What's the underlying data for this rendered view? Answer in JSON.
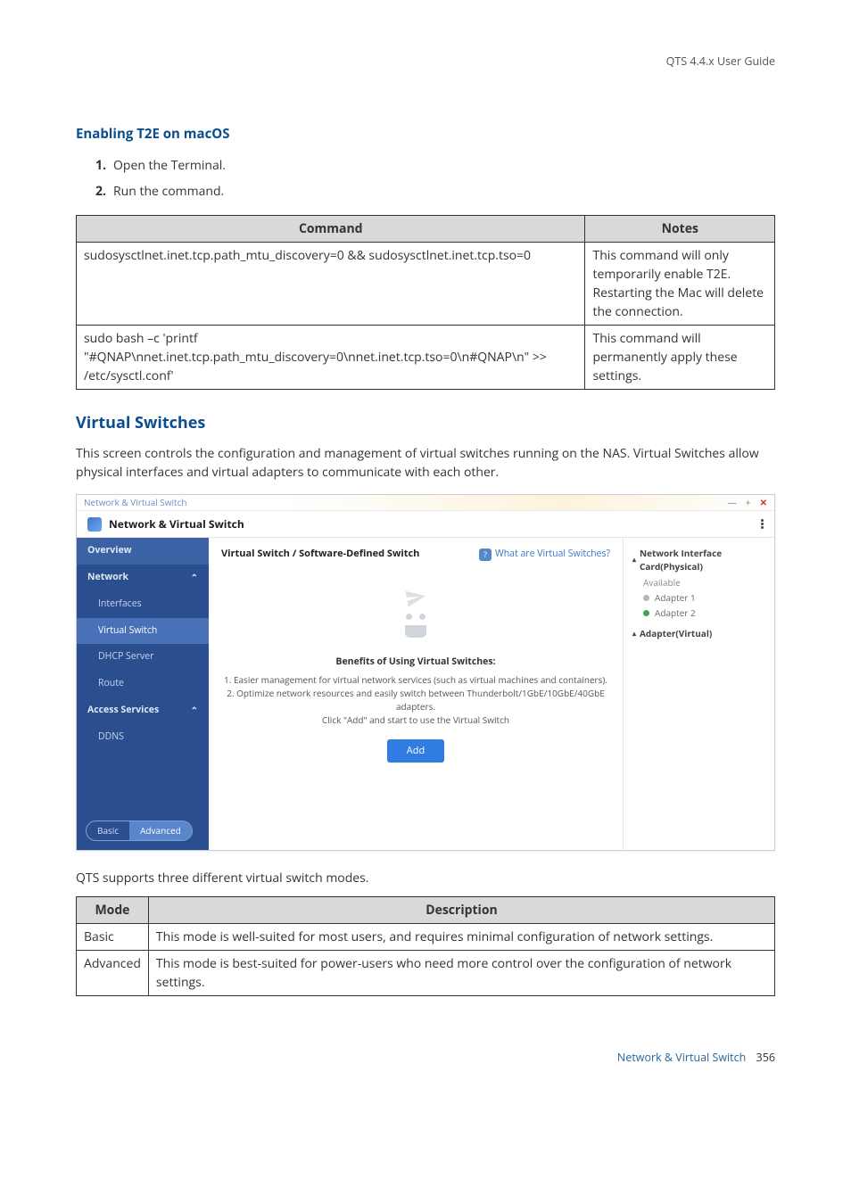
{
  "header": {
    "doc_title": "QTS 4.4.x User Guide"
  },
  "section1": {
    "heading": "Enabling T2E on macOS",
    "steps": [
      {
        "num": "1.",
        "text": "Open the Terminal."
      },
      {
        "num": "2.",
        "text": "Run the command."
      }
    ]
  },
  "table1": {
    "headers": [
      "Command",
      "Notes"
    ],
    "rows": [
      {
        "command": "sudosysctlnet.inet.tcp.path_mtu_discovery=0 && sudosysctlnet.inet.tcp.tso=0",
        "notes": "This command will only temporarily enable T2E. Restarting the Mac will delete the connection."
      },
      {
        "command": "sudo bash –c 'printf \"#QNAP\\nnet.inet.tcp.path_mtu_discovery=0\\nnet.inet.tcp.tso=0\\n#QNAP\\n\" >> /etc/sysctl.conf'",
        "notes": "This command will permanently apply these settings."
      }
    ]
  },
  "section2": {
    "heading": "Virtual Switches",
    "intro": "This screen controls the configuration and management of virtual switches running on the NAS. Virtual Switches allow physical interfaces and virtual adapters to communicate with each other."
  },
  "screenshot": {
    "window_title": "Network & Virtual Switch",
    "app_title": "Network & Virtual Switch",
    "sidebar": {
      "overview": "Overview",
      "network": "Network",
      "interfaces": "Interfaces",
      "vswitch": "Virtual Switch",
      "dhcp": "DHCP Server",
      "route": "Route",
      "access": "Access Services",
      "ddns": "DDNS",
      "basic_tab": "Basic",
      "advanced_tab": "Advanced"
    },
    "main": {
      "breadcrumb": "Virtual Switch / Software-Defined Switch",
      "help_link": "What are Virtual Switches?",
      "benefits_heading": "Benefits of Using Virtual Switches:",
      "benefit1": "1. Easier management for virtual network services (such as virtual machines and containers).",
      "benefit2": "2. Optimize network resources and easily switch between Thunderbolt/1GbE/10GbE/40GbE adapters.",
      "benefit3": "Click \"Add\" and start to use the Virtual Switch",
      "add_button": "Add"
    },
    "right": {
      "nic_header": "Network Interface Card(Physical)",
      "available": "Available",
      "adapter1": "Adapter 1",
      "adapter2": "Adapter 2",
      "virtual_header": "Adapter(Virtual)"
    }
  },
  "caption": "QTS supports three different virtual switch modes.",
  "table2": {
    "headers": [
      "Mode",
      "Description"
    ],
    "rows": [
      {
        "mode": "Basic",
        "desc": "This mode is well-suited for most users, and requires minimal configuration of network settings."
      },
      {
        "mode": "Advanced",
        "desc": "This mode is best-suited for power-users who need more control over the configuration of network settings."
      }
    ]
  },
  "footer": {
    "section": "Network & Virtual Switch",
    "page": "356"
  }
}
